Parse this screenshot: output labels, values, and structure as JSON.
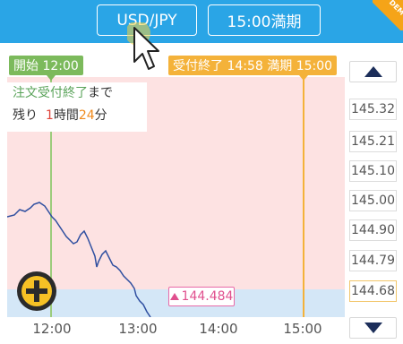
{
  "header": {
    "pair_label": "USD/JPY",
    "expiry_label": "15:00満期",
    "corner_badge": "DEM"
  },
  "markers": {
    "start_label": "開始 12:00",
    "end_label": "受付終了 14:58 満期 15:00"
  },
  "info": {
    "line1_prefix": "注文受付終了",
    "line1_suffix": "まで",
    "line2_prefix": "残り",
    "hours": "1",
    "hours_unit": "時間",
    "minutes": "24",
    "minutes_unit": "分"
  },
  "y_axis": {
    "labels": [
      "145.32",
      "145.21",
      "145.10",
      "145.00",
      "144.90",
      "144.79",
      "144.68"
    ],
    "current": "144.68"
  },
  "x_axis": {
    "labels": [
      "12:00",
      "13:00",
      "14:00",
      "15:00"
    ]
  },
  "price_tag": {
    "value": "144.484"
  },
  "colors": {
    "header_bg": "#2aa5e6",
    "start_marker": "#7cba5c",
    "end_marker": "#f4b23a",
    "price_line": "#2f4fa0",
    "plot_bg": "#fde2e2",
    "below_band": "#d4e7f7"
  },
  "icons": {
    "scroll_up": "triangle-up-icon",
    "scroll_down": "triangle-down-icon",
    "add": "plus-circle-icon",
    "cursor": "mouse-pointer-icon"
  }
}
